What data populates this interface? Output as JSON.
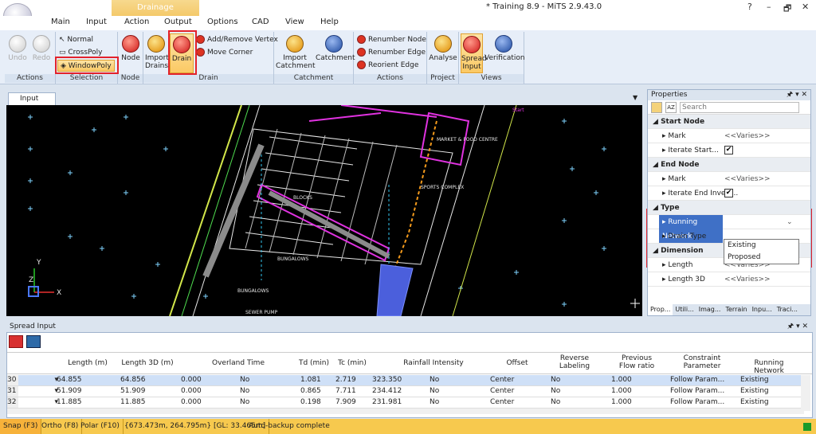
{
  "window": {
    "title": "* Training 8.9 - MiTS 2.9.43.0",
    "controls": [
      "?",
      "–",
      "🗗",
      "✕"
    ]
  },
  "context_tab": "Drainage",
  "ribbon_tabs": [
    "Main",
    "Input",
    "Action",
    "Output",
    "Options",
    "CAD",
    "View",
    "Help"
  ],
  "groups": {
    "actions": {
      "label": "Actions",
      "undo": "Undo",
      "redo": "Redo"
    },
    "selection": {
      "label": "Selection",
      "normal": "Normal",
      "crosspoly": "CrossPoly",
      "windowpoly": "WindowPoly"
    },
    "node": {
      "label": "Node",
      "node": "Node"
    },
    "drain": {
      "label": "Drain",
      "import_drains": "Import Drains",
      "drain": "Drain",
      "add_remove": "Add/Remove Vertex",
      "move_corner": "Move Corner"
    },
    "catchment": {
      "label": "Catchment",
      "import": "Import Catchment",
      "catchment": "Catchment"
    },
    "actions2": {
      "label": "Actions",
      "renumber_node": "Renumber Node",
      "renumber_edge": "Renumber Edge",
      "reorient_edge": "Reorient Edge"
    },
    "project": {
      "label": "Project",
      "analyse": "Analyse"
    },
    "views": {
      "label": "Views",
      "spread_input": "Spread Input",
      "verification": "Verification"
    }
  },
  "doc_tab": "Input",
  "canvas_labels": [
    "MARKET & FOOD CENTRE",
    "SPORTS COMPLEX",
    "BUNGALOWS",
    "BUNGALOWS",
    "SEWER PUMP",
    "BLOCKS",
    "Start"
  ],
  "properties": {
    "title": "Properties",
    "search_placeholder": "Search",
    "rows": [
      {
        "type": "cat",
        "name": "Start Node"
      },
      {
        "type": "prop",
        "name": "Mark",
        "value": "<<Varies>>"
      },
      {
        "type": "prop",
        "name": "Iterate Start...",
        "value": "✔"
      },
      {
        "type": "cat",
        "name": "End Node"
      },
      {
        "type": "prop",
        "name": "Mark",
        "value": "<<Varies>>"
      },
      {
        "type": "prop",
        "name": "Iterate End Invert...",
        "value": "✔"
      },
      {
        "type": "cat",
        "name": "Type"
      },
      {
        "type": "sel",
        "name": "Running Network",
        "value": ""
      },
      {
        "type": "prop",
        "name": "Drain Type",
        "value": ""
      },
      {
        "type": "cat",
        "name": "Dimension"
      },
      {
        "type": "prop",
        "name": "Length",
        "value": "<<Varies>>"
      },
      {
        "type": "prop",
        "name": "Length 3D",
        "value": "<<Varies>>"
      }
    ],
    "dropdown": [
      "Existing",
      "Proposed"
    ],
    "bottom_tabs": [
      "Prop...",
      "Utili...",
      "Imag...",
      "Terrain",
      "Inpu...",
      "Traci..."
    ]
  },
  "spread": {
    "title": "Spread Input",
    "headers": [
      "Length (m)",
      "Length 3D (m)",
      "Overland Time",
      "Td (min)",
      "Tc (min)",
      "Rainfall Intensity",
      "Offset",
      "Reverse Labeling",
      "Previous Flow ratio",
      "Constraint Parameter",
      "Running Network"
    ],
    "rows": [
      {
        "id": "30",
        "cells": [
          "64.855",
          "64.856",
          "0.000",
          "No",
          "1.081",
          "2.719",
          "323.350",
          "No",
          "Center",
          "No",
          "1.000",
          "Follow Param...",
          "Existing"
        ]
      },
      {
        "id": "31",
        "cells": [
          "51.909",
          "51.909",
          "0.000",
          "No",
          "0.865",
          "7.711",
          "234.412",
          "No",
          "Center",
          "No",
          "1.000",
          "Follow Param...",
          "Existing"
        ]
      },
      {
        "id": "32",
        "cells": [
          "11.885",
          "11.885",
          "0.000",
          "No",
          "0.198",
          "7.909",
          "231.981",
          "No",
          "Center",
          "No",
          "1.000",
          "Follow Param...",
          "Existing"
        ]
      }
    ]
  },
  "status": {
    "snap": "Snap (F3)",
    "ortho": "Ortho (F8)",
    "polar": "Polar (F10)",
    "coords": "{673.473m, 264.795m} [GL: 33.465m]",
    "msg": "Auto-backup complete"
  }
}
